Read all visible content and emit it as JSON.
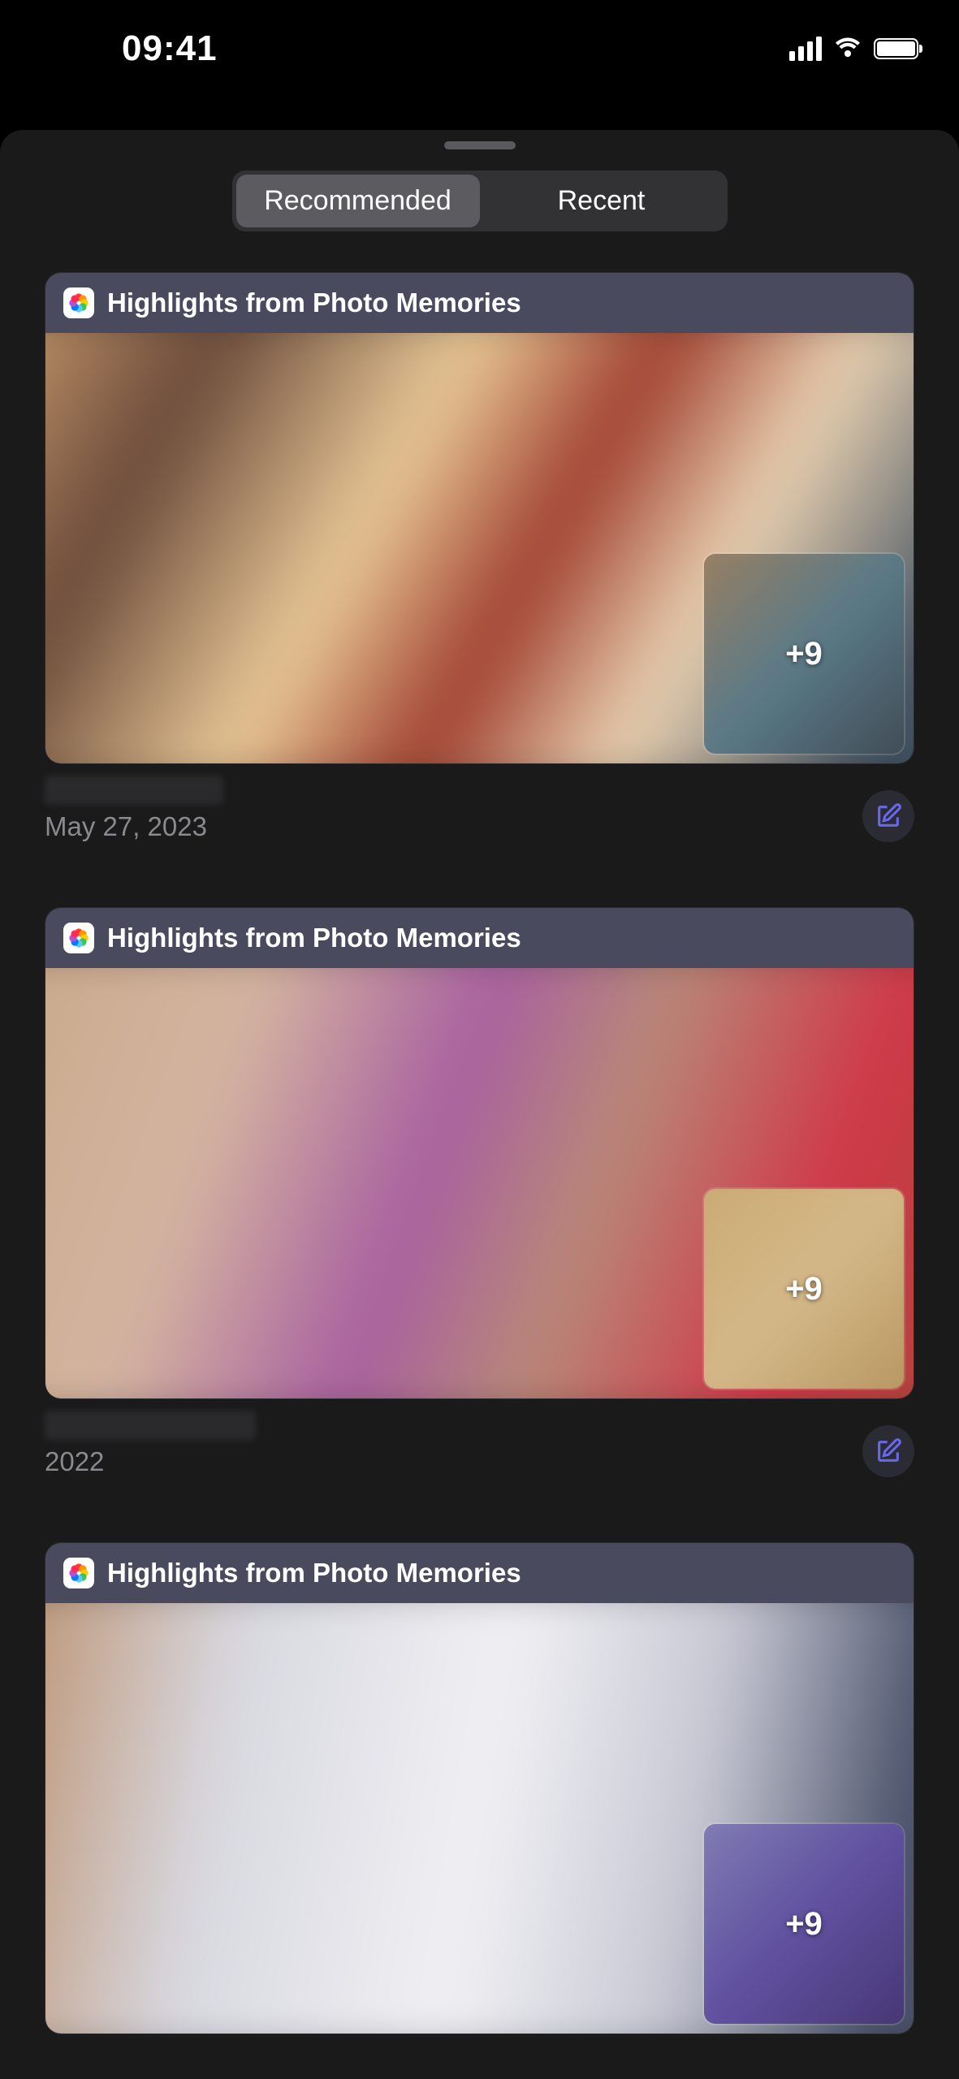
{
  "status": {
    "time": "09:41"
  },
  "segments": {
    "recommended": "Recommended",
    "recent": "Recent",
    "active": "recommended"
  },
  "cards": [
    {
      "title": "Highlights from Photo Memories",
      "more_count": "+9",
      "date": "May 27, 2023"
    },
    {
      "title": "Highlights from Photo Memories",
      "more_count": "+9",
      "date": "2022"
    },
    {
      "title": "Highlights from Photo Memories",
      "more_count": "+9",
      "date": ""
    }
  ]
}
